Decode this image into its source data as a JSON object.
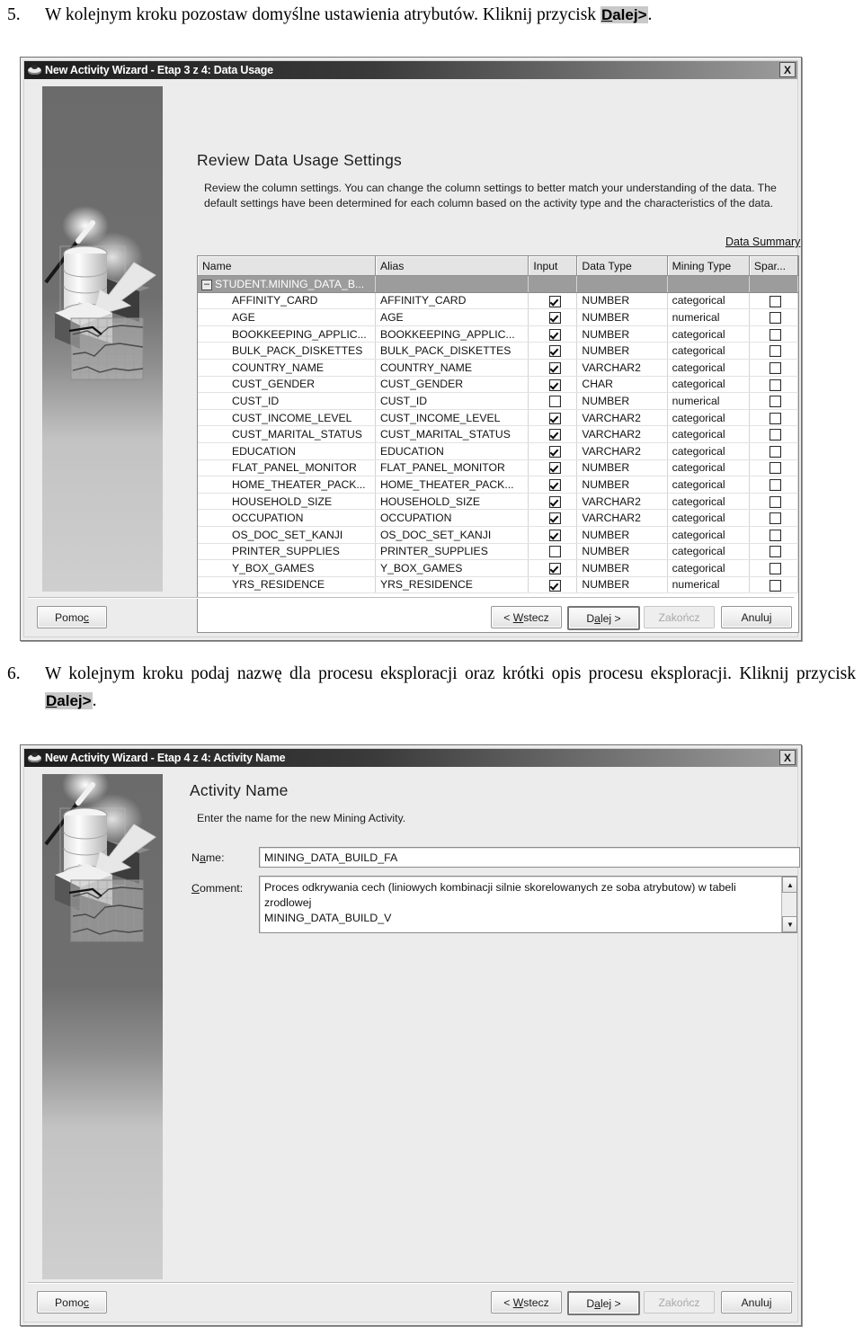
{
  "doc": {
    "step5": {
      "number": "5.",
      "text_before": "W kolejnym kroku pozostaw domyślne ustawienia atrybutów. Kliknij przycisk ",
      "button_ref_u": "D",
      "button_ref_rest": "alej>",
      "text_after": "."
    },
    "step6": {
      "number": "6.",
      "text_before": "W kolejnym kroku podaj nazwę dla procesu eksploracji oraz krótki opis procesu eksploracji. Kliknij przycisk ",
      "button_ref_u": "D",
      "button_ref_rest": "alej>",
      "text_after": "."
    }
  },
  "dialog1": {
    "title": "New Activity Wizard - Etap 3 z 4: Data Usage",
    "icon": "wizard-icon",
    "close_label": "X",
    "pane_title": "Review Data Usage Settings",
    "pane_desc_line1": "Review the column settings. You can change the column settings to better match your understanding of the data. The",
    "pane_desc_line2": "default settings have been determined for each column based on the activity type and the characteristics of the data.",
    "data_summary_link": "Data Summary",
    "grid": {
      "columns": [
        "Name",
        "Alias",
        "Input",
        "Data Type",
        "Mining Type",
        "Spar..."
      ],
      "group_row": "STUDENT.MINING_DATA_B...",
      "rows": [
        {
          "name": "AFFINITY_CARD",
          "alias": "AFFINITY_CARD",
          "input": true,
          "type": "NUMBER",
          "mining": "categorical",
          "sparse": false
        },
        {
          "name": "AGE",
          "alias": "AGE",
          "input": true,
          "type": "NUMBER",
          "mining": "numerical",
          "sparse": false
        },
        {
          "name": "BOOKKEEPING_APPLIC...",
          "alias": "BOOKKEEPING_APPLIC...",
          "input": true,
          "type": "NUMBER",
          "mining": "categorical",
          "sparse": false
        },
        {
          "name": "BULK_PACK_DISKETTES",
          "alias": "BULK_PACK_DISKETTES",
          "input": true,
          "type": "NUMBER",
          "mining": "categorical",
          "sparse": false
        },
        {
          "name": "COUNTRY_NAME",
          "alias": "COUNTRY_NAME",
          "input": true,
          "type": "VARCHAR2",
          "mining": "categorical",
          "sparse": false
        },
        {
          "name": "CUST_GENDER",
          "alias": "CUST_GENDER",
          "input": true,
          "type": "CHAR",
          "mining": "categorical",
          "sparse": false
        },
        {
          "name": "CUST_ID",
          "alias": "CUST_ID",
          "input": false,
          "type": "NUMBER",
          "mining": "numerical",
          "sparse": false
        },
        {
          "name": "CUST_INCOME_LEVEL",
          "alias": "CUST_INCOME_LEVEL",
          "input": true,
          "type": "VARCHAR2",
          "mining": "categorical",
          "sparse": false
        },
        {
          "name": "CUST_MARITAL_STATUS",
          "alias": "CUST_MARITAL_STATUS",
          "input": true,
          "type": "VARCHAR2",
          "mining": "categorical",
          "sparse": false
        },
        {
          "name": "EDUCATION",
          "alias": "EDUCATION",
          "input": true,
          "type": "VARCHAR2",
          "mining": "categorical",
          "sparse": false
        },
        {
          "name": "FLAT_PANEL_MONITOR",
          "alias": "FLAT_PANEL_MONITOR",
          "input": true,
          "type": "NUMBER",
          "mining": "categorical",
          "sparse": false
        },
        {
          "name": "HOME_THEATER_PACK...",
          "alias": "HOME_THEATER_PACK...",
          "input": true,
          "type": "NUMBER",
          "mining": "categorical",
          "sparse": false
        },
        {
          "name": "HOUSEHOLD_SIZE",
          "alias": "HOUSEHOLD_SIZE",
          "input": true,
          "type": "VARCHAR2",
          "mining": "categorical",
          "sparse": false
        },
        {
          "name": "OCCUPATION",
          "alias": "OCCUPATION",
          "input": true,
          "type": "VARCHAR2",
          "mining": "categorical",
          "sparse": false
        },
        {
          "name": "OS_DOC_SET_KANJI",
          "alias": "OS_DOC_SET_KANJI",
          "input": true,
          "type": "NUMBER",
          "mining": "categorical",
          "sparse": false
        },
        {
          "name": "PRINTER_SUPPLIES",
          "alias": "PRINTER_SUPPLIES",
          "input": false,
          "type": "NUMBER",
          "mining": "categorical",
          "sparse": false
        },
        {
          "name": "Y_BOX_GAMES",
          "alias": "Y_BOX_GAMES",
          "input": true,
          "type": "NUMBER",
          "mining": "categorical",
          "sparse": false
        },
        {
          "name": "YRS_RESIDENCE",
          "alias": "YRS_RESIDENCE",
          "input": true,
          "type": "NUMBER",
          "mining": "numerical",
          "sparse": false
        }
      ]
    },
    "buttons": {
      "help": "Pomoc",
      "help_u": "c",
      "back": "< Wstecz",
      "back_u": "W",
      "next": "Dalej >",
      "next_u": "a",
      "finish": "Zakończ",
      "cancel": "Anuluj"
    }
  },
  "dialog2": {
    "title": "New Activity Wizard - Etap 4 z 4: Activity Name",
    "icon": "wizard-icon",
    "close_label": "X",
    "pane_title": "Activity Name",
    "pane_desc_line1": "Enter the name for the new Mining Activity.",
    "name_label": "Name:",
    "name_value": "MINING_DATA_BUILD_FA",
    "comment_label": "Comment:",
    "comment_line1": "Proces odkrywania cech (liniowych kombinacji silnie skorelowanych ze soba atrybutow) w tabeli zrodlowej",
    "comment_line2": "MINING_DATA_BUILD_V",
    "scroll_up": "▲",
    "scroll_down": "▼",
    "buttons": {
      "help": "Pomoc",
      "help_u": "c",
      "back": "< Wstecz",
      "back_u": "W",
      "next": "Dalej >",
      "next_u": "a",
      "finish": "Zakończ",
      "cancel": "Anuluj"
    }
  }
}
